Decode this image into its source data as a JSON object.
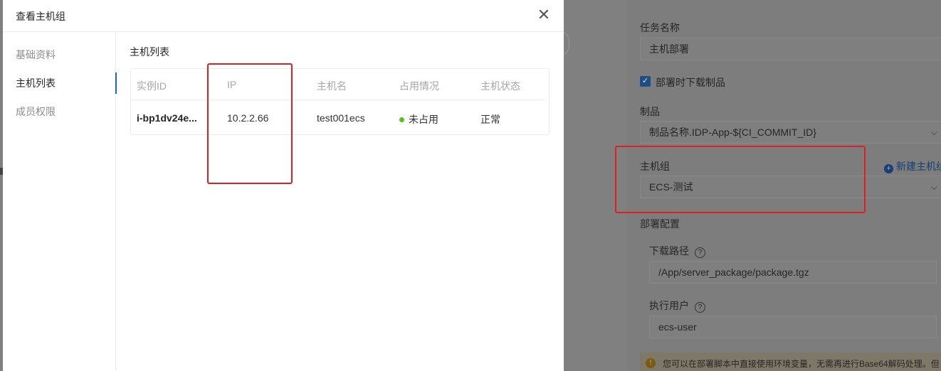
{
  "modal": {
    "title": "查看主机组",
    "close_label": "✕",
    "sidebar": [
      {
        "label": "基础资料"
      },
      {
        "label": "主机列表"
      },
      {
        "label": "成员权限"
      }
    ],
    "active_tab": "主机列表",
    "section_title": "主机列表",
    "table": {
      "columns": [
        "实例ID",
        "IP",
        "主机名",
        "占用情况",
        "主机状态"
      ],
      "rows": [
        {
          "instance_id": "i-bp1dv24e...",
          "ip": "10.2.2.66",
          "hostname": "test001ecs",
          "occupancy": "未占用",
          "status": "正常"
        }
      ]
    }
  },
  "right_panel": {
    "task_name_label": "任务名称",
    "task_name_value": "主机部署",
    "download_checkbox_label": "部署时下载制品",
    "artifact_label": "制品",
    "artifact_value": "制品名称.IDP-App-${CI_COMMIT_ID}",
    "host_group_label": "主机组",
    "new_host_group_label": "新建主机组",
    "host_group_value": "ECS-测试",
    "deploy_config_label": "部署配置",
    "download_path_label": "下载路径",
    "download_path_value": "/App/server_package/package.tgz",
    "exec_user_label": "执行用户",
    "exec_user_value": "ecs-user",
    "warning_text": "您可以在部署脚本中直接使用环境变量，无需再进行Base64解码处理。但"
  },
  "icons": {
    "close": "close-icon",
    "chevron": "chevron-down-icon",
    "check": "checkbox-check-icon",
    "plus": "plus-circle-icon",
    "help": "question-circle-icon",
    "warning": "warning-icon"
  },
  "colors": {
    "accent": "#1b66c9",
    "highlight": "#e02020",
    "status_ok": "#52c41a"
  }
}
